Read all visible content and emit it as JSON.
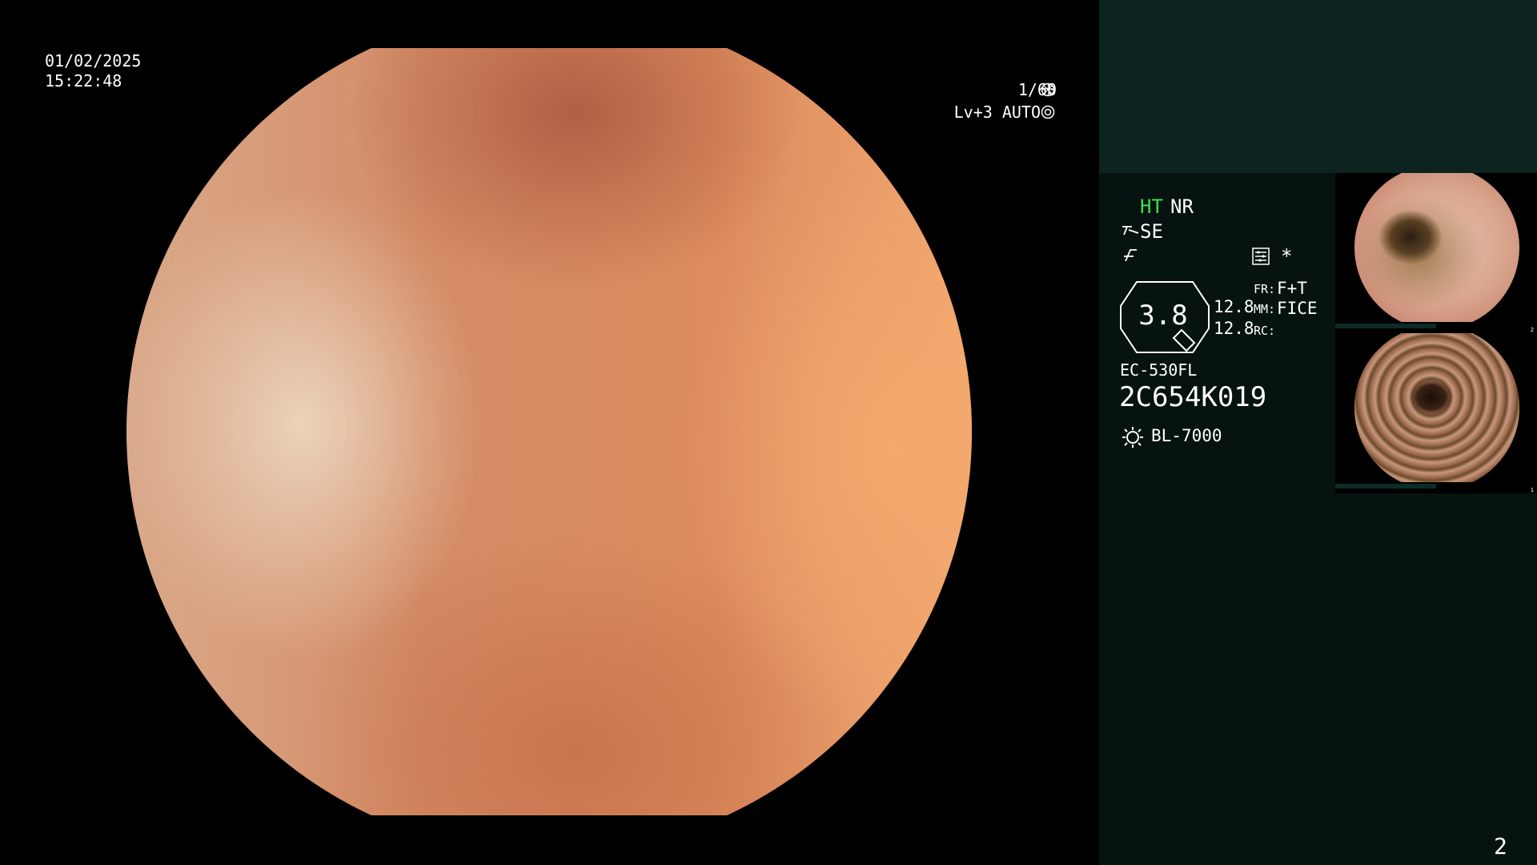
{
  "main_view": {
    "date": "01/02/2025",
    "time": "15:22:48",
    "shutter": "1/60",
    "level": "Lv+3 AUTO"
  },
  "panel": {
    "ht": "HT",
    "nr": "NR",
    "se": "SE",
    "star": "*",
    "zoom": "3.8",
    "value_1": "12.8",
    "value_2": "12.8",
    "fr_key": "FR:",
    "fr_val": "F+T",
    "mm_key": "MM:",
    "mm_val": "FICE",
    "rc_key": "RC:",
    "scope_model": "EC-530FL",
    "scope_serial": "2C654K019",
    "light_source": "BL-7000"
  },
  "thumbnails": [
    {
      "num": "2"
    },
    {
      "num": "1"
    }
  ],
  "page_number": "2",
  "colors": {
    "panel_bg": "#061311",
    "panel_top": "#0c2320",
    "ht_green": "#3ee04a"
  },
  "icons": [
    "shutter-icon",
    "auto-iris-icon",
    "structure-enhance-icon",
    "filter-icon",
    "menu-icon",
    "light-source-icon",
    "zoom-badge-icon"
  ]
}
